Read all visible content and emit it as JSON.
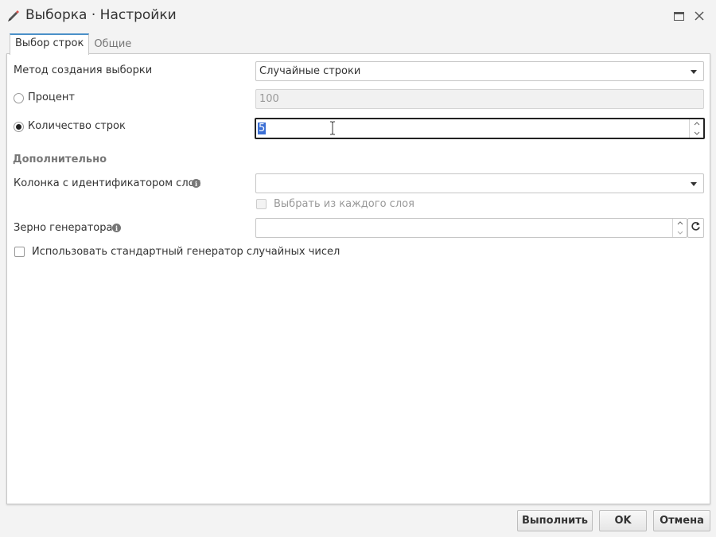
{
  "window": {
    "title": "Выборка · Настройки",
    "icons": {
      "title": "pencil-brush-icon",
      "maximize": "maximize-icon",
      "close": "close-icon"
    }
  },
  "tabs": [
    {
      "label": "Выбор строк",
      "active": true
    },
    {
      "label": "Общие",
      "active": false
    }
  ],
  "form": {
    "method": {
      "label": "Метод создания выборки",
      "value": "Случайные строки"
    },
    "percent": {
      "label": "Процент",
      "value": "100",
      "selected": false
    },
    "row_count": {
      "label": "Количество строк",
      "value": "5",
      "selected": true
    },
    "section_title": "Дополнительно",
    "stratum_column": {
      "label": "Колонка с идентификатором слоя",
      "value": ""
    },
    "from_each_stratum": {
      "label": "Выбрать из каждого слоя",
      "checked": false
    },
    "seed": {
      "label": "Зерно генератора",
      "value": ""
    },
    "use_default_rng": {
      "label": "Использовать стандартный генератор случайных чисел",
      "checked": false
    }
  },
  "buttons": {
    "run": "Выполнить",
    "ok": "OK",
    "cancel": "Отмена"
  },
  "colors": {
    "accent": "#4a90c8",
    "selection": "#3b6fd4"
  }
}
